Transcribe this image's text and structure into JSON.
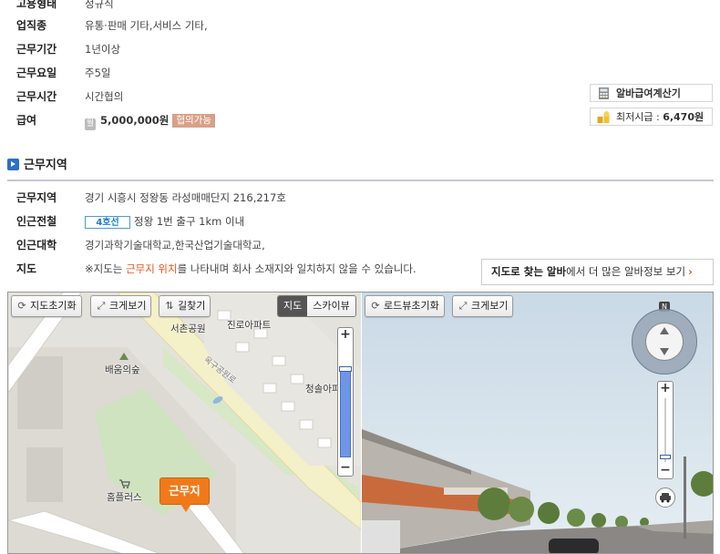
{
  "info_rows": [
    {
      "label": "고용형태",
      "value": "정규직"
    },
    {
      "label": "업직종",
      "value": "유통·판매 기타,서비스 기타,"
    },
    {
      "label": "근무기간",
      "value": "1년이상"
    },
    {
      "label": "근무요일",
      "value": "주5일"
    },
    {
      "label": "근무시간",
      "value": "시간협의"
    }
  ],
  "pay": {
    "label": "급여",
    "icon_text": "월",
    "amount": "5,000,000원",
    "badge": "협의가능"
  },
  "side": {
    "calc_label": "알바급여계산기",
    "min_wage_label": "최저시급 : ",
    "min_wage_value": "6,470원"
  },
  "section": {
    "title": "근무지역"
  },
  "location": {
    "address_label": "근무지역",
    "address": "경기 시흥시 정왕동 라성매매단지 216,217호",
    "subway_label": "인근전철",
    "subway_line": "4호선",
    "subway_text": "정왕 1번 출구 1km 이내",
    "univ_label": "인근대학",
    "univ_text": "경기과학기술대학교,한국산업기술대학교,",
    "map_label": "지도",
    "map_note_pre": "※지도는 ",
    "map_note_hl": "근무지 위치",
    "map_note_post": "를 나타내며 회사 소재지와 일치하지 않을 수 있습니다."
  },
  "map_link": {
    "bold": "지도로 찾는 알바",
    "rest": "에서 더 많은 알바정보 보기",
    "arrow": "›"
  },
  "map": {
    "reset_label": "지도초기화",
    "enlarge_label": "크게보기",
    "route_label": "길찾기",
    "mode_map": "지도",
    "mode_sky": "스카이뷰",
    "zoom_in": "+",
    "zoom_out": "−",
    "marker_label": "근무지",
    "places": {
      "park": "서촌공원",
      "apt1": "진로아파트",
      "forest": "배움의숲",
      "road": "옥구공원로",
      "apt2": "청솔아파",
      "mart": "홈플러스"
    }
  },
  "roadview": {
    "reset_label": "로드뷰초기화",
    "enlarge_label": "크게보기",
    "compass_n": "N",
    "zoom_in": "+",
    "zoom_out": "−"
  },
  "colors": {
    "accent": "#2e6fc9",
    "highlight": "#e8541a",
    "marker": "#f07a1a",
    "badge": "#d9a088"
  }
}
